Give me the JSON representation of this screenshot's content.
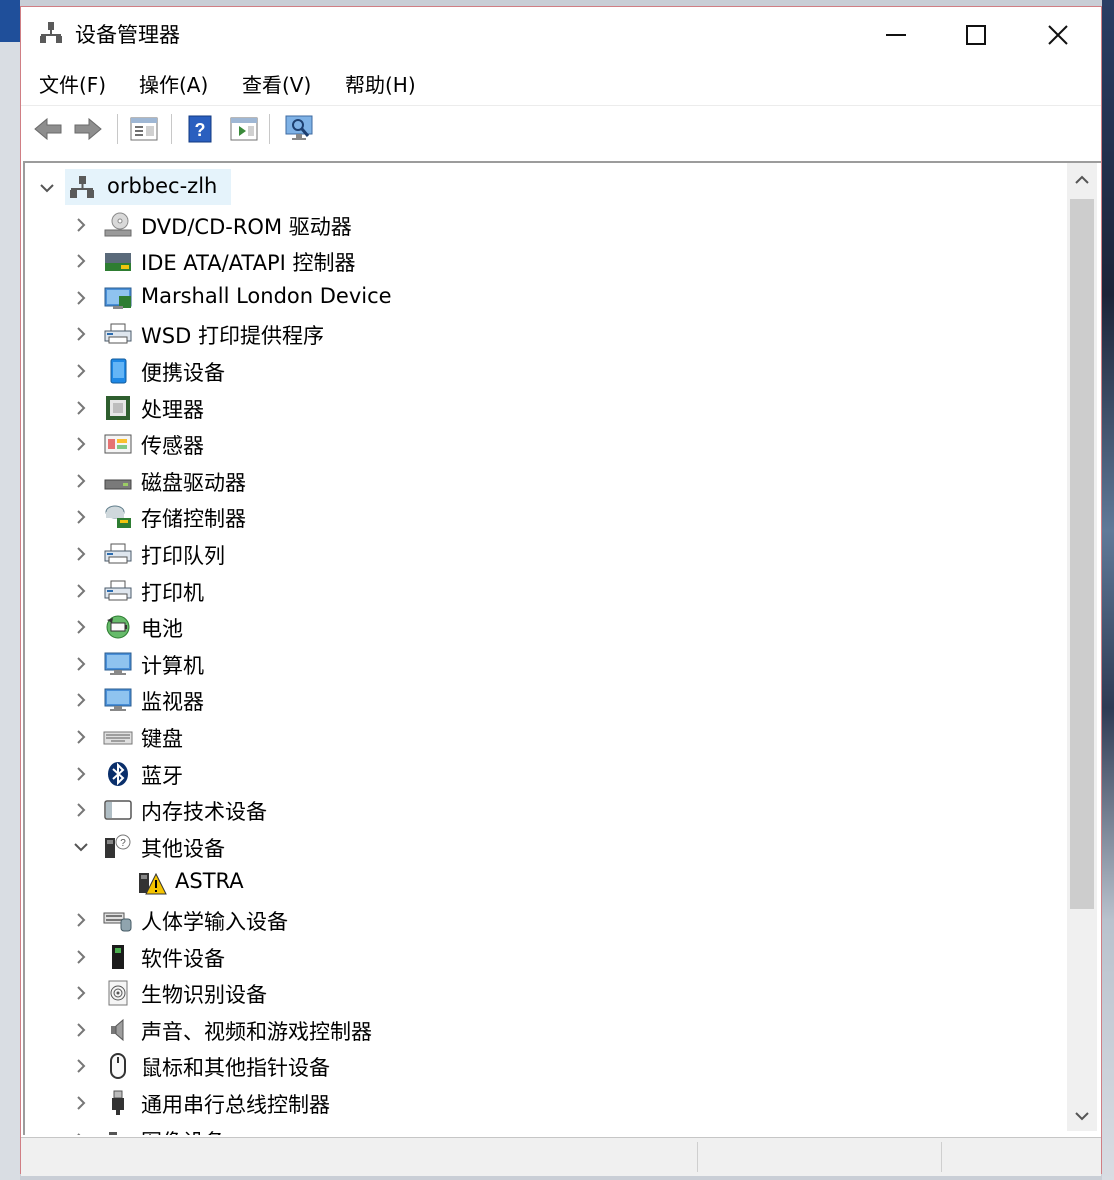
{
  "window": {
    "title": "设备管理器"
  },
  "menu": [
    "文件(F)",
    "操作(A)",
    "查看(V)",
    "帮助(H)"
  ],
  "toolbar": [
    "back-arrow-icon",
    "forward-arrow-icon",
    "properties-icon",
    "help-icon",
    "update-driver-icon",
    "scan-hardware-icon"
  ],
  "tree": {
    "root": "orbbec-zlh",
    "items": [
      {
        "label": "DVD/CD-ROM 驱动器",
        "icon": "dvd-drive-icon"
      },
      {
        "label": "IDE ATA/ATAPI 控制器",
        "icon": "ide-controller-icon"
      },
      {
        "label": "Marshall London Device",
        "icon": "phone-device-icon"
      },
      {
        "label": "WSD 打印提供程序",
        "icon": "printer-icon"
      },
      {
        "label": "便携设备",
        "icon": "portable-device-icon"
      },
      {
        "label": "处理器",
        "icon": "processor-icon"
      },
      {
        "label": "传感器",
        "icon": "sensor-icon"
      },
      {
        "label": "磁盘驱动器",
        "icon": "disk-drive-icon"
      },
      {
        "label": "存储控制器",
        "icon": "storage-controller-icon"
      },
      {
        "label": "打印队列",
        "icon": "printer-icon"
      },
      {
        "label": "打印机",
        "icon": "printer-icon"
      },
      {
        "label": "电池",
        "icon": "battery-icon"
      },
      {
        "label": "计算机",
        "icon": "computer-icon"
      },
      {
        "label": "监视器",
        "icon": "monitor-icon"
      },
      {
        "label": "键盘",
        "icon": "keyboard-icon"
      },
      {
        "label": "蓝牙",
        "icon": "bluetooth-icon"
      },
      {
        "label": "内存技术设备",
        "icon": "memory-device-icon"
      },
      {
        "label": "其他设备",
        "icon": "unknown-device-icon",
        "expanded": true
      },
      {
        "label": "ASTRA",
        "icon": "warning-device-icon",
        "child": true
      },
      {
        "label": "人体学输入设备",
        "icon": "hid-icon"
      },
      {
        "label": "软件设备",
        "icon": "software-device-icon"
      },
      {
        "label": "生物识别设备",
        "icon": "fingerprint-icon"
      },
      {
        "label": "声音、视频和游戏控制器",
        "icon": "speaker-icon"
      },
      {
        "label": "鼠标和其他指针设备",
        "icon": "mouse-icon"
      },
      {
        "label": "通用串行总线控制器",
        "icon": "usb-icon"
      },
      {
        "label": "图像设备",
        "icon": "camera-icon"
      }
    ]
  },
  "colors": {
    "accent_border": "#d07e84",
    "selection": "#e5f3fb",
    "warning": "#f5c400"
  }
}
